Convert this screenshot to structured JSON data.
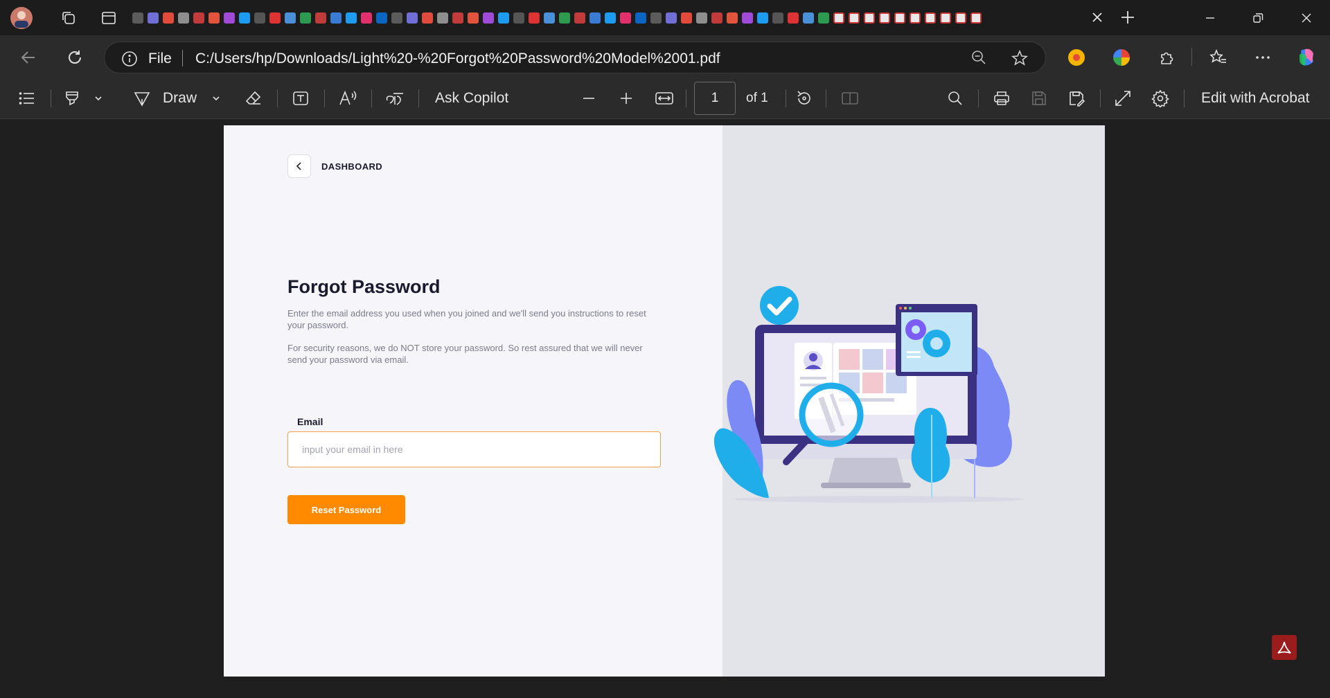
{
  "browser": {
    "address": {
      "scheme_label": "File",
      "url": "C:/Users/hp/Downloads/Light%20-%20Forgot%20Password%20Model%2001.pdf"
    },
    "tab_count_favicons": 56
  },
  "pdf_toolbar": {
    "draw_label": "Draw",
    "ask_copilot_label": "Ask Copilot",
    "page_number": "1",
    "page_total_label": "of 1",
    "edit_acrobat_label": "Edit with Acrobat"
  },
  "document": {
    "back_label": "DASHBOARD",
    "title": "Forgot Password",
    "para1": "Enter the email address you used when you joined and we'll send you instructions to reset your password.",
    "para2": "For security reasons, we do NOT store your password. So rest assured that we will never send your password via email.",
    "email_label": "Email",
    "email_placeholder": "input your email in here",
    "email_value": "",
    "reset_button_label": "Reset Password"
  },
  "colors": {
    "accent": "#ff8a00",
    "page_left_bg": "#f5f5fa",
    "page_right_bg": "#e3e4ea",
    "browser_dark": "#2b2b2b"
  }
}
